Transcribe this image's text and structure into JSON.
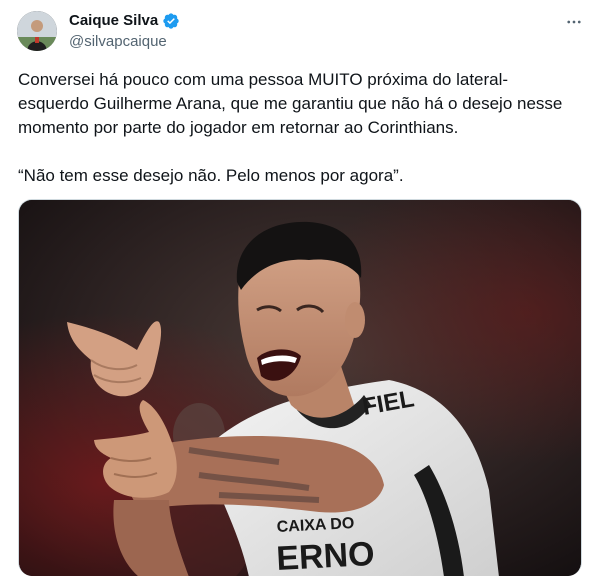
{
  "author": {
    "display_name": "Caique Silva",
    "handle": "@silvapcaique",
    "verified": true
  },
  "tweet": {
    "paragraphs": [
      "Conversei há pouco com uma pessoa MUITO próxima do lateral-esquerdo Guilherme Arana, que me garantiu que não há o desejo nesse momento por parte do jogador em retornar ao Corinthians.",
      "“Não tem esse desejo não. Pelo menos por agora”."
    ]
  },
  "media": {
    "shirt_sponsor": "FIEL",
    "shirt_lower_text": "CAIXA DO",
    "shirt_bottom_text": "ERNO"
  },
  "icons": {
    "verified": "verified-badge-icon",
    "more": "more-icon"
  },
  "colors": {
    "verified_blue": "#1d9bf0",
    "handle_gray": "#536471",
    "text": "#0f1419"
  }
}
